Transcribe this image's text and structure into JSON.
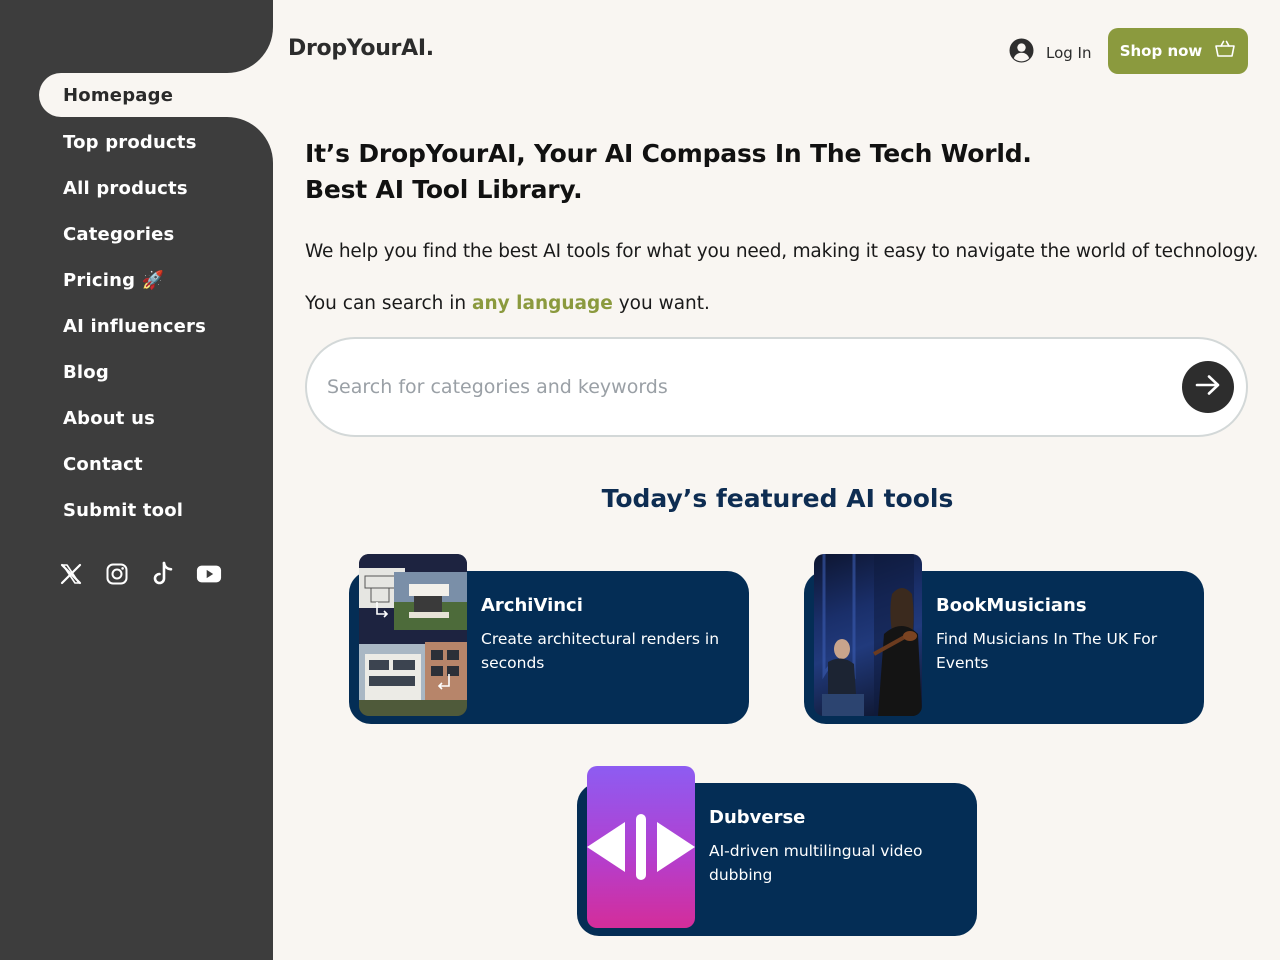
{
  "brand": {
    "logo": "DropYourAI."
  },
  "sidebar": {
    "items": [
      {
        "label": "Homepage",
        "active": true
      },
      {
        "label": "Top products"
      },
      {
        "label": "All products"
      },
      {
        "label": "Categories"
      },
      {
        "label": "Pricing 🚀"
      },
      {
        "label": "AI influencers"
      },
      {
        "label": "Blog"
      },
      {
        "label": "About us"
      },
      {
        "label": "Contact"
      },
      {
        "label": "Submit tool"
      }
    ],
    "socials": [
      "x-icon",
      "instagram-icon",
      "tiktok-icon",
      "youtube-icon"
    ]
  },
  "header": {
    "login_label": "Log In",
    "shop_label": "Shop now"
  },
  "hero": {
    "title_line1": "It’s DropYourAI, Your AI Compass In The Tech World.",
    "title_line2": "Best AI Tool Library.",
    "description": "We help you find the best AI tools for what you need, making it easy to navigate the world of technology.",
    "lang_prefix": "You can search in ",
    "lang_highlight": "any language",
    "lang_suffix": " you want."
  },
  "search": {
    "placeholder": "Search for categories and keywords",
    "value": ""
  },
  "featured": {
    "title": "Today’s featured AI tools",
    "tools": [
      {
        "name": "ArchiVinci",
        "description": "Create architectural renders in seconds"
      },
      {
        "name": "BookMusicians",
        "description": "Find Musicians In The UK For Events"
      },
      {
        "name": "Dubverse",
        "description": "AI-driven multilingual video dubbing"
      }
    ]
  },
  "colors": {
    "sidebar_bg": "#3d3d3d",
    "page_bg": "#f9f6f2",
    "accent_olive": "#8b9a3e",
    "card_navy": "#042d55",
    "heading_navy": "#0e2d52"
  }
}
